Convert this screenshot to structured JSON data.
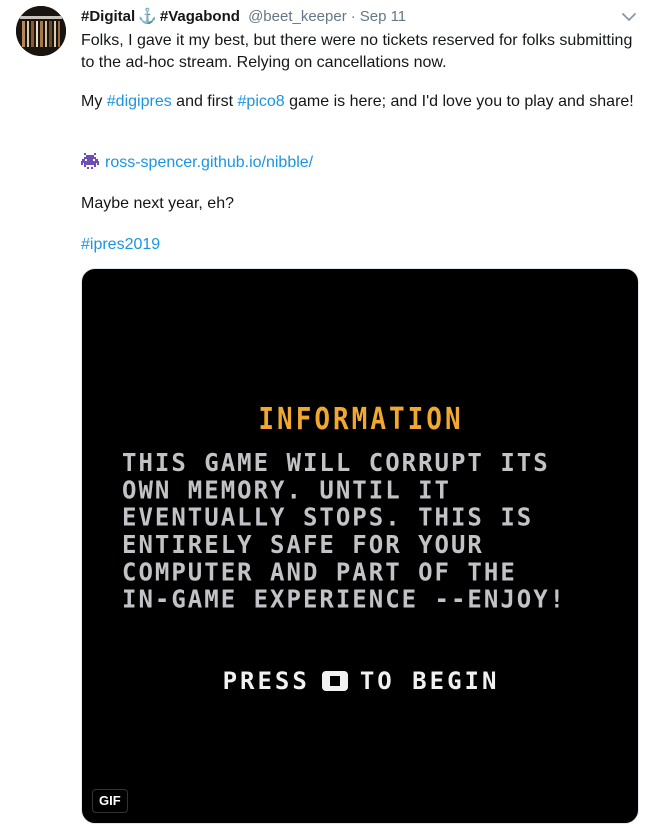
{
  "tweet": {
    "display_name_part1": "#Digital",
    "anchor_symbol": "⚓",
    "display_name_part2": "#Vagabond",
    "handle": "@beet_keeper",
    "separator": "·",
    "date": "Sep 11",
    "paragraph1": "Folks, I gave it my best, but there were no tickets reserved for folks submitting to the ad-hoc stream. Relying on cancellations now.",
    "paragraph2_prefix": "My ",
    "hashtag_digipres": "#digipres",
    "paragraph2_middle": " and first ",
    "hashtag_pico8": "#pico8",
    "paragraph2_suffix": " game is here; and I'd love you to play and share!",
    "link_text": "ross-spencer.github.io/nibble/",
    "paragraph4": "Maybe next year, eh?",
    "hashtag_ipres": "#ipres2019"
  },
  "media": {
    "info_title": "INFORMATION",
    "info_body": "THIS GAME WILL CORRUPT ITS\nOWN MEMORY. UNTIL IT\nEVENTUALLY STOPS. THIS IS\nENTIRELY SAFE FOR YOUR\nCOMPUTER AND PART OF THE\nIN-GAME EXPERIENCE --ENJOY!",
    "press_prefix": "PRESS",
    "press_suffix": "TO BEGIN",
    "badge": "GIF"
  },
  "icons": {
    "avatar": "bookshelf-avatar",
    "menu": "chevron-down-icon",
    "link_emoji": "space-invader-icon"
  },
  "colors": {
    "link": "#1b95e0",
    "muted": "#657786",
    "info_title": "#f0a830"
  }
}
